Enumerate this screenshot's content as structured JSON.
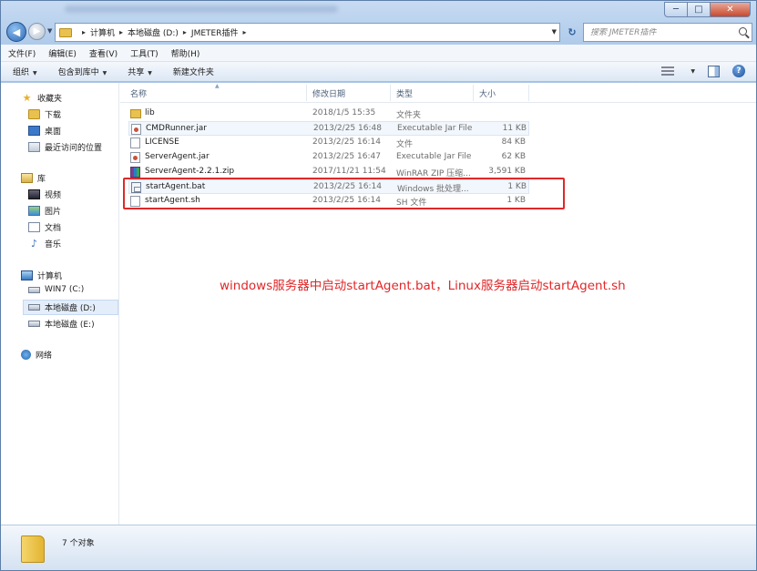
{
  "window": {
    "controls": {
      "minimize": "─",
      "maximize": "□",
      "close": "✕"
    }
  },
  "address": {
    "back_glyph": "◀",
    "forward_glyph": "▶",
    "crumbs": [
      "计算机",
      "本地磁盘 (D:)",
      "JMETER插件"
    ],
    "search_placeholder": "搜索 JMETER插件"
  },
  "menu": {
    "items": [
      "文件(F)",
      "编辑(E)",
      "查看(V)",
      "工具(T)",
      "帮助(H)"
    ]
  },
  "toolbar": {
    "items": [
      "组织",
      "包含到库中",
      "共享",
      "新建文件夹"
    ],
    "help_glyph": "?"
  },
  "sidebar": {
    "favorites": {
      "label": "收藏夹",
      "items": [
        "下载",
        "桌面",
        "最近访问的位置"
      ]
    },
    "libraries": {
      "label": "库",
      "items": [
        "视频",
        "图片",
        "文档",
        "音乐"
      ]
    },
    "computer": {
      "label": "计算机",
      "items": [
        "WIN7 (C:)",
        "本地磁盘 (D:)",
        "本地磁盘 (E:)"
      ]
    },
    "network": {
      "label": "网络"
    }
  },
  "columns": {
    "name": "名称",
    "date": "修改日期",
    "type": "类型",
    "size": "大小"
  },
  "files": [
    {
      "name": "lib",
      "date": "2018/1/5 15:35",
      "type": "文件夹",
      "size": "",
      "icon": "folder-icon"
    },
    {
      "name": "CMDRunner.jar",
      "date": "2013/2/25 16:48",
      "type": "Executable Jar File",
      "size": "11 KB",
      "icon": "jar-file-icon"
    },
    {
      "name": "LICENSE",
      "date": "2013/2/25 16:14",
      "type": "文件",
      "size": "84 KB",
      "icon": "file-icon"
    },
    {
      "name": "ServerAgent.jar",
      "date": "2013/2/25 16:47",
      "type": "Executable Jar File",
      "size": "62 KB",
      "icon": "jar-file-icon"
    },
    {
      "name": "ServerAgent-2.2.1.zip",
      "date": "2017/11/21 11:54",
      "type": "WinRAR ZIP 压缩...",
      "size": "3,591 KB",
      "icon": "zip-file-icon"
    },
    {
      "name": "startAgent.bat",
      "date": "2013/2/25 16:14",
      "type": "Windows 批处理...",
      "size": "1 KB",
      "icon": "bat-file-icon"
    },
    {
      "name": "startAgent.sh",
      "date": "2013/2/25 16:14",
      "type": "SH 文件",
      "size": "1 KB",
      "icon": "file-icon"
    }
  ],
  "annotation": "windows服务器中启动startAgent.bat，Linux服务器启动startAgent.sh",
  "status": {
    "count": "7 个对象"
  },
  "colors": {
    "highlight_box": "#e0282a",
    "annotation_text": "#e0282a"
  }
}
